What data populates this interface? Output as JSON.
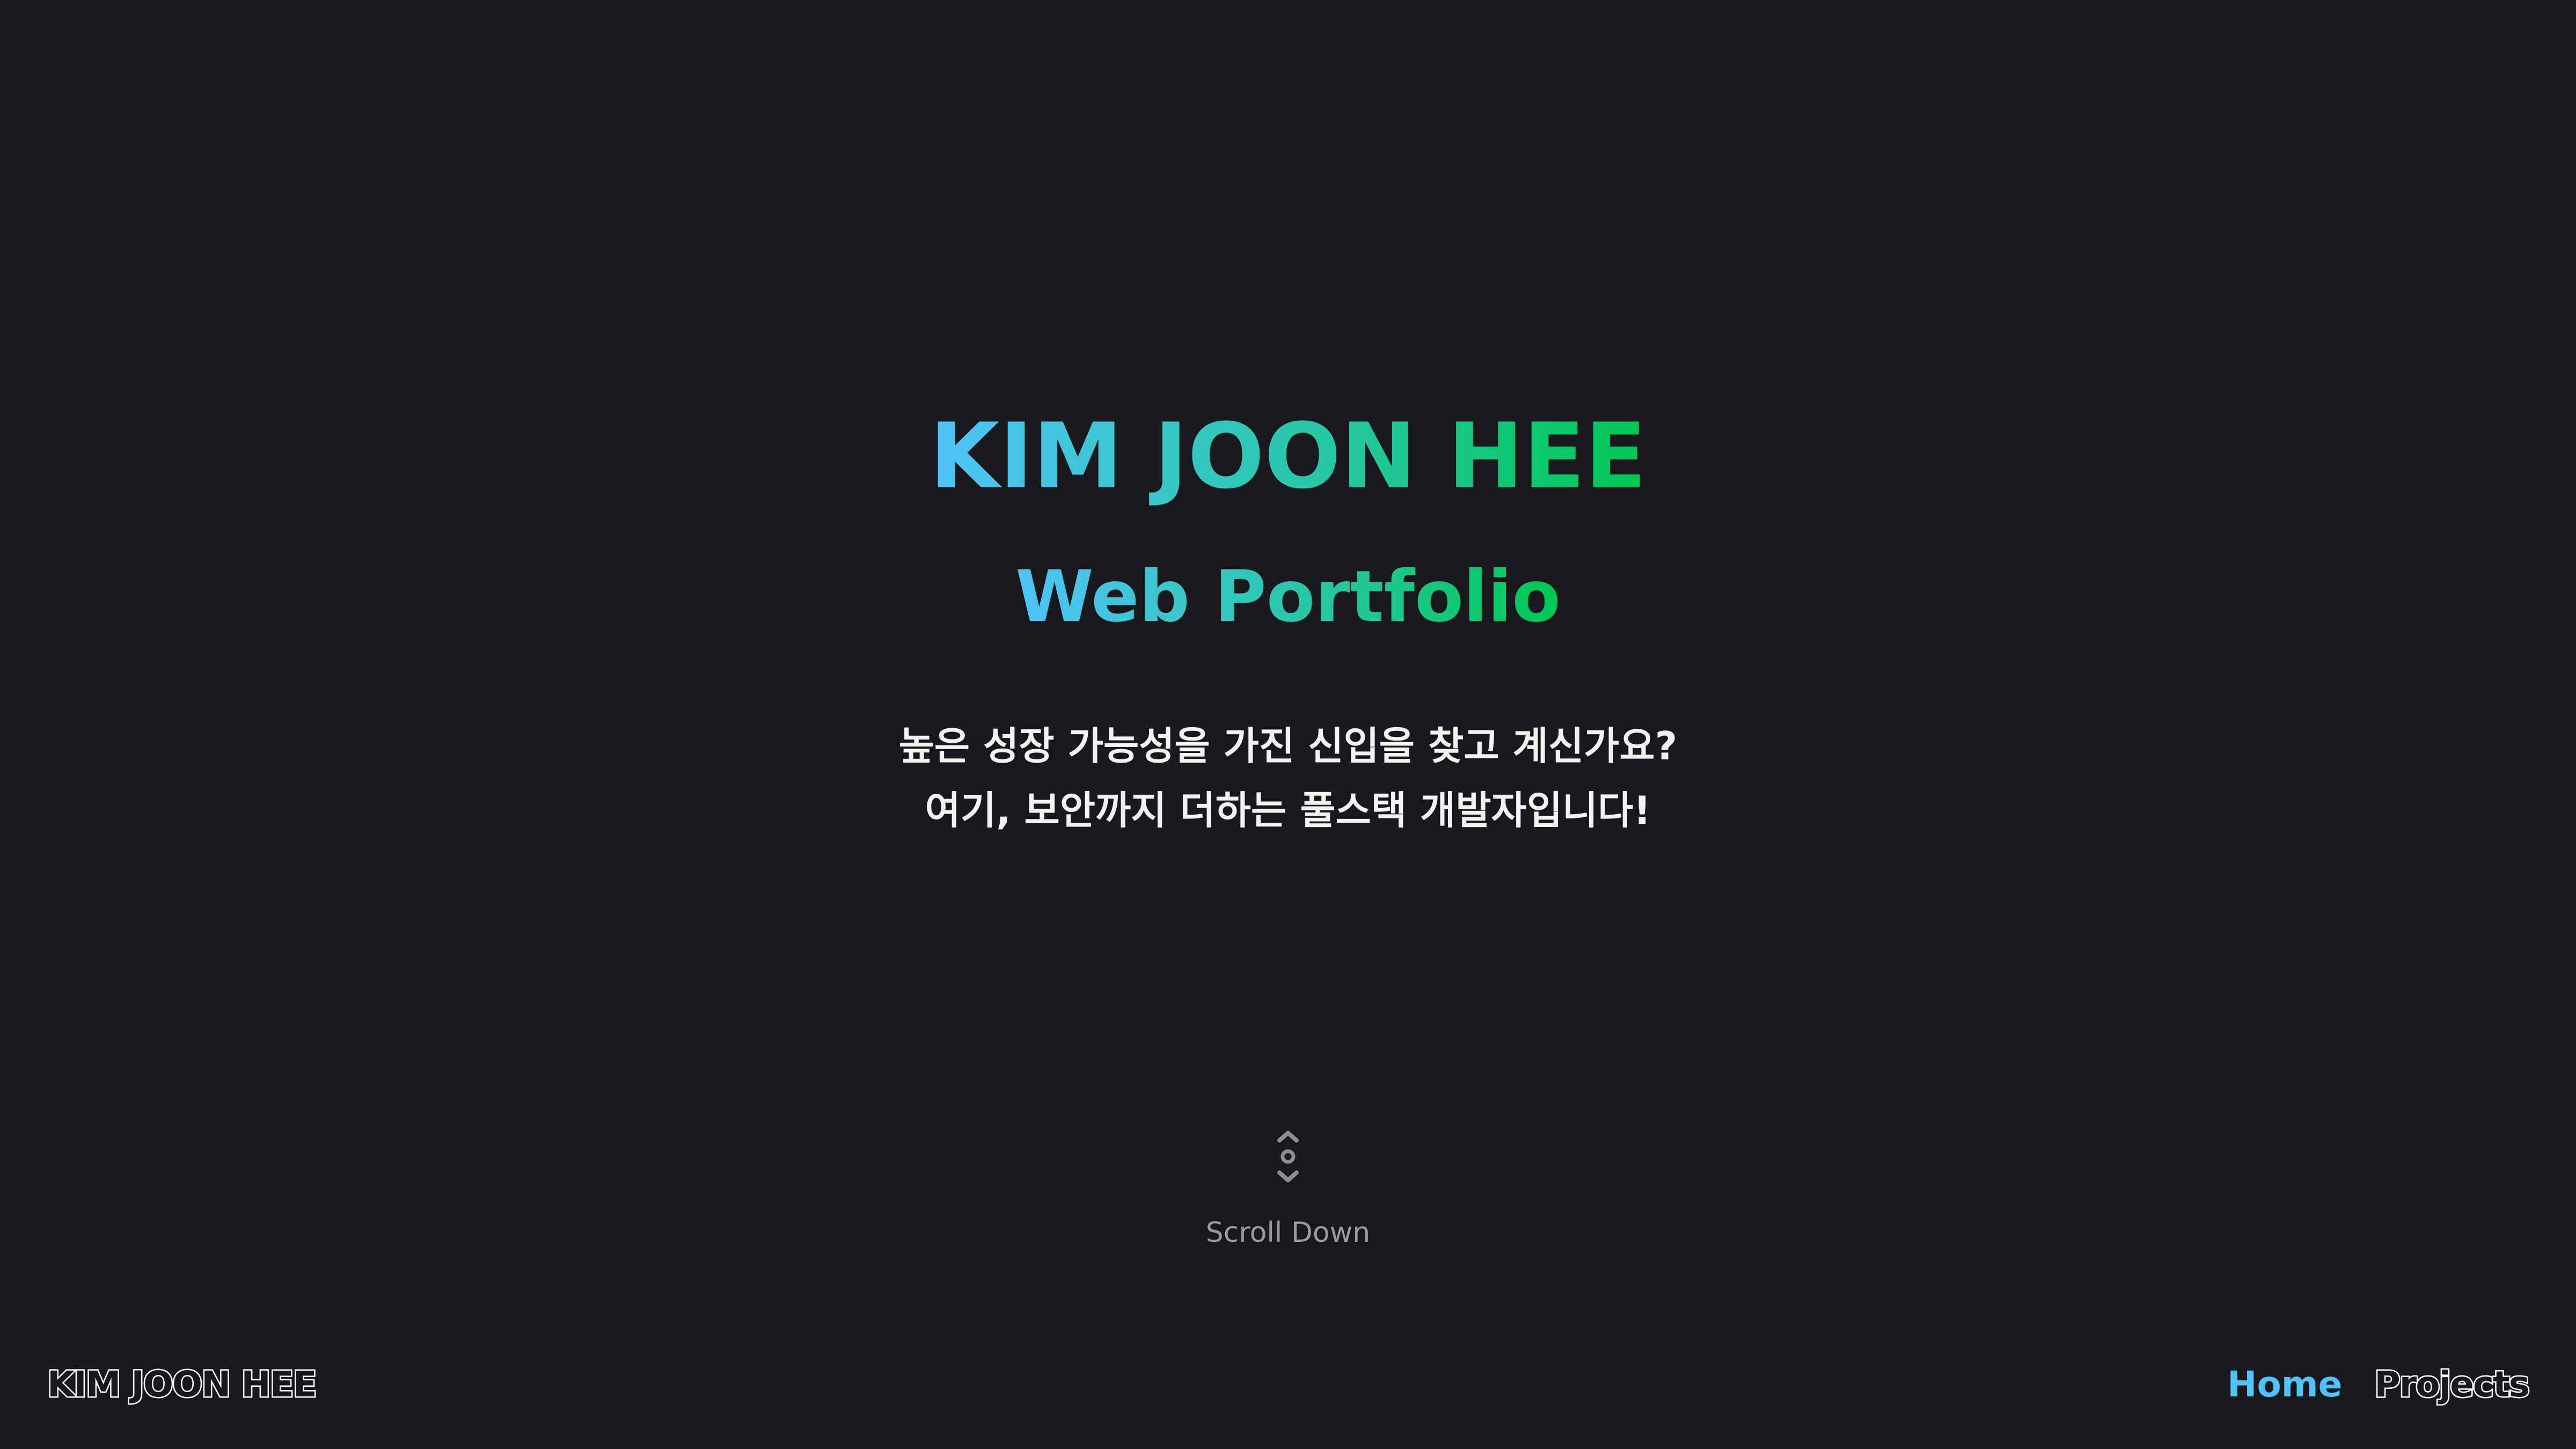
{
  "hero": {
    "title": "KIM JOON HEE",
    "subtitle": "Web Portfolio",
    "description_lines": [
      "높은 성장 가능성을 가진 신입을 찾고 계신가요?",
      "여기, 보안까지 더하는 풀스택 개발자입니다!"
    ],
    "scroll_label": "Scroll Down",
    "scroll_icon": "scroll-down-icon"
  },
  "nav": {
    "brand": "KIM JOON HEE",
    "links": [
      {
        "label": "Home",
        "active": true
      },
      {
        "label": "Projects",
        "active": false
      }
    ]
  },
  "colors": {
    "background": "#18191d",
    "gradient_start": "#4fc3f7",
    "gradient_end": "#00c853",
    "active_link": "#4fc3f7",
    "muted_text": "#9a9ba0"
  }
}
